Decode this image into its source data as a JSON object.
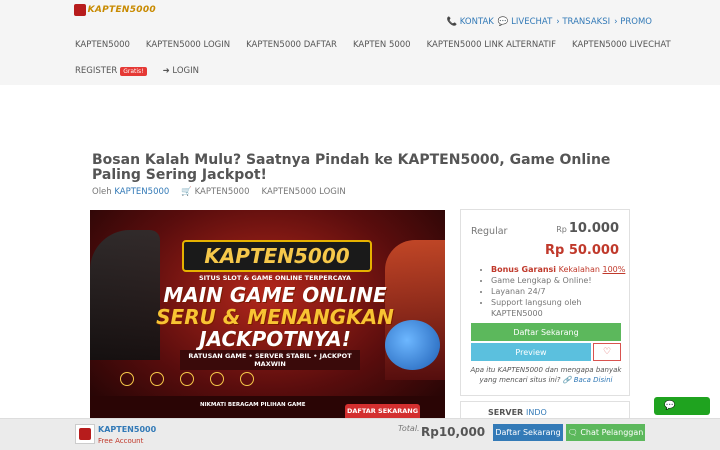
{
  "header": {
    "logo_text": "KAPTEN5000",
    "top_links": [
      "📞 KONTAK",
      "💬 LIVECHAT",
      "› TRANSAKSI",
      "› PROMO"
    ],
    "nav": [
      "KAPTEN5000",
      "KAPTEN5000 LOGIN",
      "KAPTEN5000 DAFTAR",
      "KAPTEN 5000",
      "KAPTEN5000 LINK ALTERNATIF",
      "KAPTEN5000 LIVECHAT"
    ],
    "register_label": "REGISTER",
    "register_badge": "Gratis!",
    "login_label": "➜ LOGIN"
  },
  "article": {
    "title": "Bosan Kalah Mulu? Saatnya Pindah ke KAPTEN5000, Game Online Paling Sering Jackpot!",
    "by_label": "Oleh",
    "author": "KAPTEN5000",
    "category": "🛒 KAPTEN5000",
    "tag": "KAPTEN5000 LOGIN"
  },
  "banner": {
    "brand": "KAPTEN5000",
    "subtitle": "SITUS SLOT & GAME ONLINE TERPERCAYA",
    "headline_1": "MAIN GAME ONLINE",
    "headline_2": "SERU & MENANGKAN",
    "headline_3": "JACKPOTNYA!",
    "strip": "RATUSAN GAME • SERVER STABIL • JACKPOT MAXWIN",
    "bottom_text": "NIKMATI BERAGAM PILIHAN GAME",
    "cta": "DAFTAR SEKARANG"
  },
  "pricing": {
    "plan": "Regular",
    "currency": "Rp",
    "old_price": "10.000",
    "new_price": "Rp 50.000",
    "feature_bonus_bold": "Bonus Garansi",
    "feature_bonus_rest": "Kekalahan",
    "feature_bonus_pct": "100%",
    "feature_2": "Game Lengkap & Online!",
    "feature_3": "Layanan 24/7",
    "feature_4": "Support langsung oleh KAPTEN5000",
    "buy_label": "Daftar Sekarang",
    "preview_label": "Preview",
    "fav_icon": "♡",
    "note": "Apa itu KAPTEN5000 dan mengapa banyak yang mencari situs ini?",
    "note_link": "🔗 Baca Disini"
  },
  "server": {
    "label": "SERVER",
    "value": "INDO"
  },
  "footer": {
    "name": "KAPTEN5000",
    "sub": "Free Account",
    "total_label": "Total.",
    "total_value": "Rp10,000",
    "buy_label": "Daftar Sekarang",
    "chat_label": "🗨 Chat Pelanggan"
  },
  "chat_float_icon": "💬"
}
